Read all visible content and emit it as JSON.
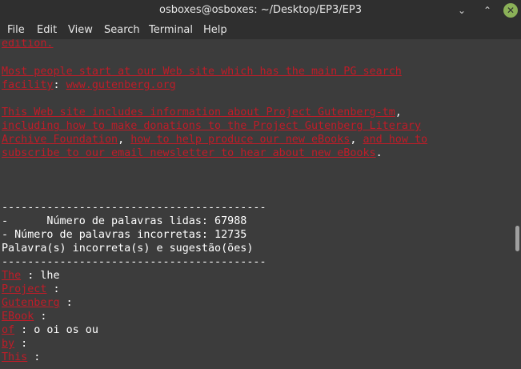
{
  "window": {
    "title": "osboxes@osboxes: ~/Desktop/EP3/EP3",
    "minimize_glyph": "⌄",
    "maximize_glyph": "⌃",
    "close_glyph": "✕"
  },
  "menu": {
    "items": [
      "File",
      "Edit",
      "View",
      "Search",
      "Terminal",
      "Help"
    ]
  },
  "terminal": {
    "text_color": "#ffffff",
    "highlight_color": "#c01c28",
    "background": "#3c3c3c",
    "para1_tail": "edition.",
    "para2_line1": "Most people start at our Web site which has the main PG search",
    "para2_line2_a": "facility",
    "para2_line2_b": ": ",
    "para2_line2_c": "www.gutenberg.org",
    "para3_line1_a": "This Web site includes information about Project Gutenberg-tm",
    "para3_line1_b": ",",
    "para3_line2": "including how to make donations to the Project Gutenberg Literary",
    "para3_line3_a": "Archive Foundation",
    "para3_line3_b": ", ",
    "para3_line3_c": "how to help produce our new eBooks",
    "para3_line3_d": ", ",
    "para3_line3_e": "and how to",
    "para3_line4_a": "subscribe to our email newsletter to hear about new eBooks",
    "para3_line4_b": ".",
    "separator": "-----------------------------------------",
    "stat_words_read": "-      Número de palavras lidas: 67988",
    "stat_words_wrong": "- Número de palavras incorretas: 12735",
    "stat_header": "Palavra(s) incorreta(s) e sugestão(ões)",
    "results": [
      {
        "word": "The",
        "suffix": " : lhe"
      },
      {
        "word": "Project",
        "suffix": " :"
      },
      {
        "word": "Gutenberg",
        "suffix": " :"
      },
      {
        "word": "EBook",
        "suffix": " :"
      },
      {
        "word": "of",
        "suffix": " : o oi os ou"
      },
      {
        "word": "by",
        "suffix": " :"
      },
      {
        "word": "This",
        "suffix": " :"
      }
    ]
  }
}
